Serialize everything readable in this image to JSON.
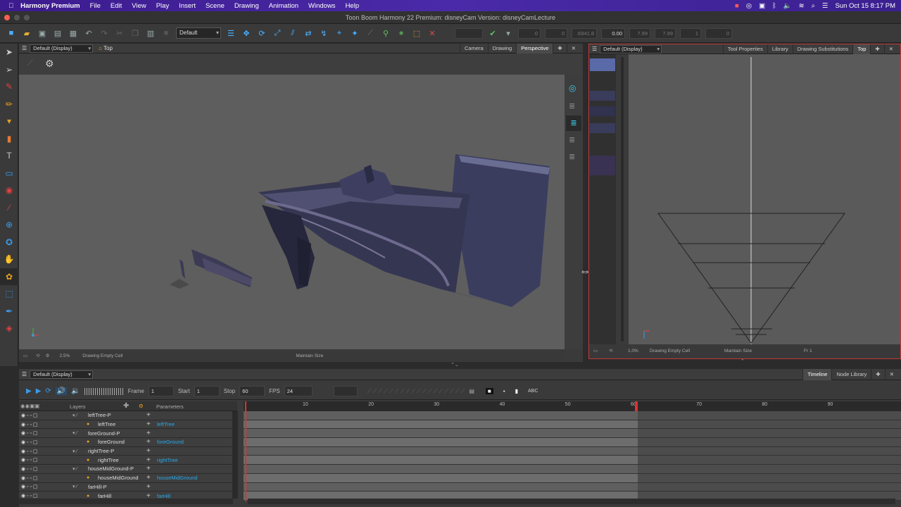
{
  "menubar": {
    "app_name": "Harmony Premium",
    "items": [
      "File",
      "Edit",
      "View",
      "Play",
      "Insert",
      "Scene",
      "Drawing",
      "Animation",
      "Windows",
      "Help"
    ],
    "datetime": "Sun Oct 15  8:17 PM"
  },
  "window": {
    "title": "Toon Boom Harmony 22 Premium: disneyCam Version: disneyCamLecture"
  },
  "toolbar": {
    "workspace_combo": "Default",
    "fields": [
      "0",
      "0",
      ".6941.8",
      "0.00",
      "7.99",
      "7.99",
      "1",
      "0"
    ]
  },
  "perspective_view": {
    "display_combo": "Default (Display)",
    "view_label": "Top",
    "tabs": [
      "Camera",
      "Drawing",
      "Perspective"
    ],
    "active_tab": "Perspective",
    "status": {
      "zoom": "2.5%",
      "drawing": "Drawing Empty Cell",
      "mode": "Maintain Size"
    }
  },
  "top_view": {
    "display_combo": "Default (Display)",
    "tabs": [
      "Tool Properties",
      "Library",
      "Drawing Substitutions",
      "Top"
    ],
    "active_tab": "Top",
    "status": {
      "zoom": "1.0%",
      "drawing": "Drawing Empty Cell",
      "mode": "Maintain Size",
      "frame": "Fr 1"
    }
  },
  "timeline": {
    "display_combo": "Default (Display)",
    "tabs": [
      "Timeline",
      "Node Library"
    ],
    "active_tab": "Timeline",
    "frame_label": "Frame",
    "frame_value": "1",
    "start_label": "Start",
    "start_value": "1",
    "stop_label": "Stop",
    "stop_value": "60",
    "fps_label": "FPS",
    "fps_value": "24",
    "layers_header": "Layers",
    "parameters_header": "Parameters",
    "ruler_ticks": [
      "10",
      "20",
      "30",
      "40",
      "50",
      "60",
      "70",
      "80",
      "90"
    ],
    "layers": [
      {
        "name": "leftTree-P",
        "param": "",
        "indent": 1,
        "group": true
      },
      {
        "name": "leftTree",
        "param": "leftTree",
        "indent": 2,
        "group": false
      },
      {
        "name": "foreGround-P",
        "param": "",
        "indent": 1,
        "group": true
      },
      {
        "name": "foreGround",
        "param": "foreGround",
        "indent": 2,
        "group": false
      },
      {
        "name": "rightTree-P",
        "param": "",
        "indent": 1,
        "group": true
      },
      {
        "name": "rightTree",
        "param": "rightTree",
        "indent": 2,
        "group": false
      },
      {
        "name": "houseMidGround-P",
        "param": "",
        "indent": 1,
        "group": true
      },
      {
        "name": "houseMidGround",
        "param": "houseMidGround",
        "indent": 2,
        "group": false
      },
      {
        "name": "farHill-P",
        "param": "",
        "indent": 1,
        "group": true
      },
      {
        "name": "farHill",
        "param": "farHill",
        "indent": 2,
        "group": false
      }
    ]
  }
}
